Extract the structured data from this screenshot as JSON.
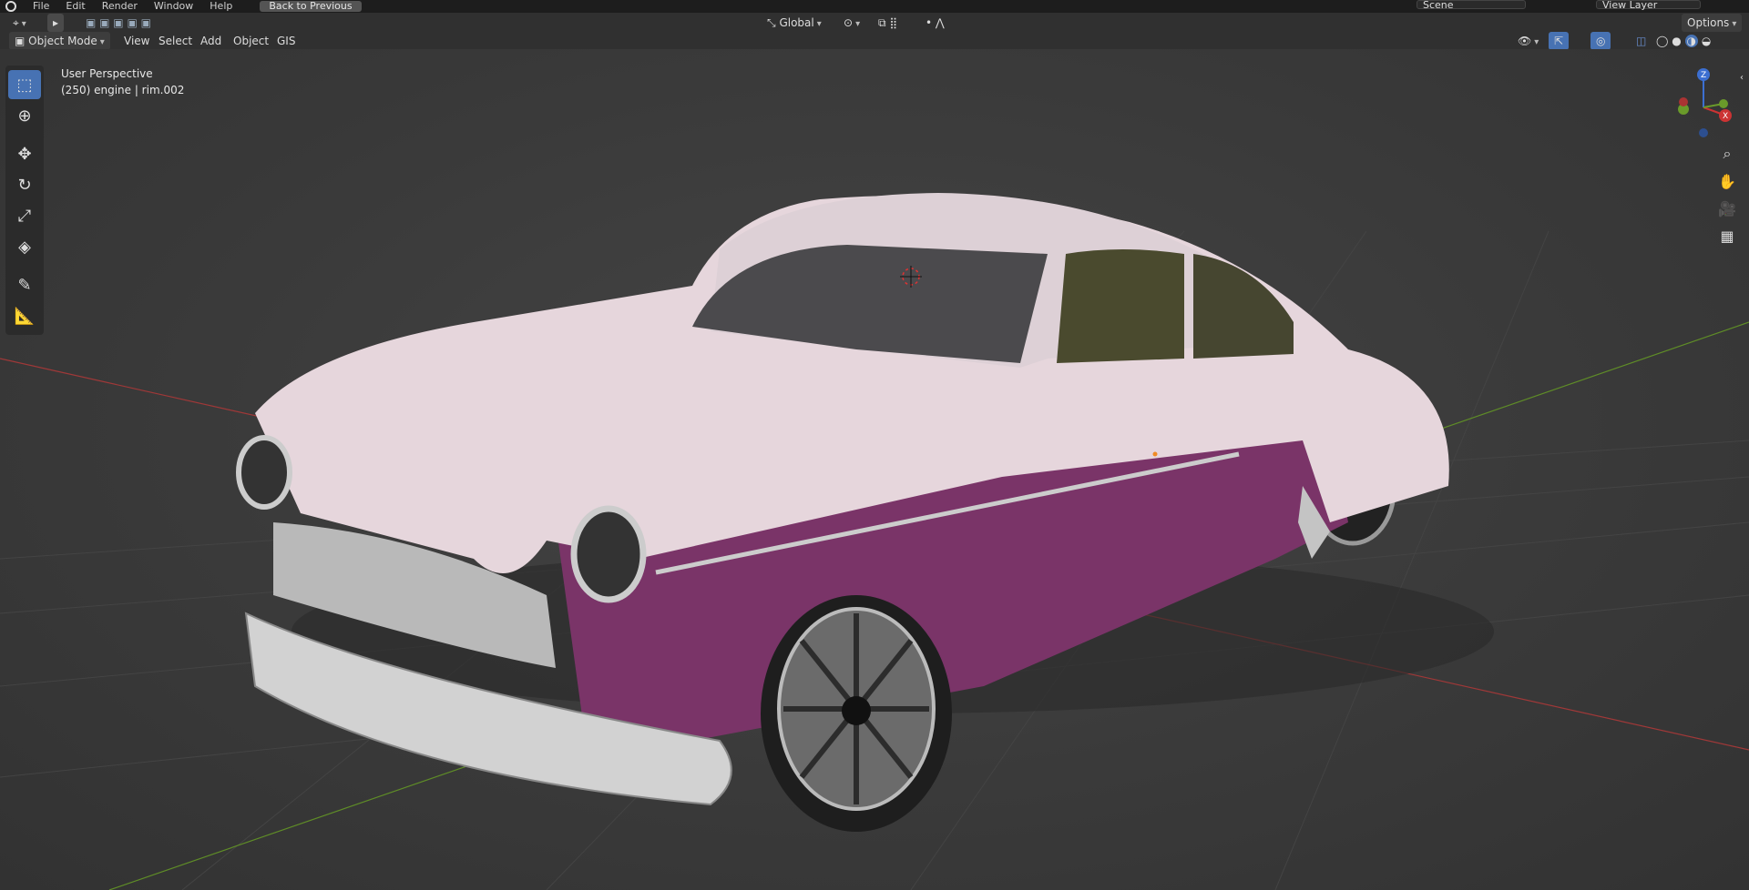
{
  "topbar": {
    "menus": [
      "File",
      "Edit",
      "Render",
      "Window",
      "Help"
    ],
    "back_label": "Back to Previous",
    "scene": "Scene",
    "view_layer": "View Layer"
  },
  "header": {
    "mode": "Object Mode",
    "menus": [
      "View",
      "Select",
      "Add",
      "Object",
      "GIS"
    ],
    "transform_orientation": "Global",
    "options": "Options"
  },
  "viewport": {
    "perspective": "User Perspective",
    "object_info": "(250) engine | rim.002"
  },
  "colors": {
    "accent": "#4772b3",
    "body_upper": "#e6d6dc",
    "body_lower": "#7a3468",
    "chrome": "#c8c8c8",
    "axis_x": "#b23a3a",
    "axis_y": "#6a9a2a"
  },
  "icons": {
    "tools": [
      "select-box-icon",
      "cursor-icon",
      "move-icon",
      "rotate-icon",
      "scale-icon",
      "transform-icon",
      "annotate-icon",
      "measure-icon"
    ],
    "nav": [
      "zoom-icon",
      "hand-pan-icon",
      "camera-icon",
      "grid-ortho-icon"
    ]
  }
}
